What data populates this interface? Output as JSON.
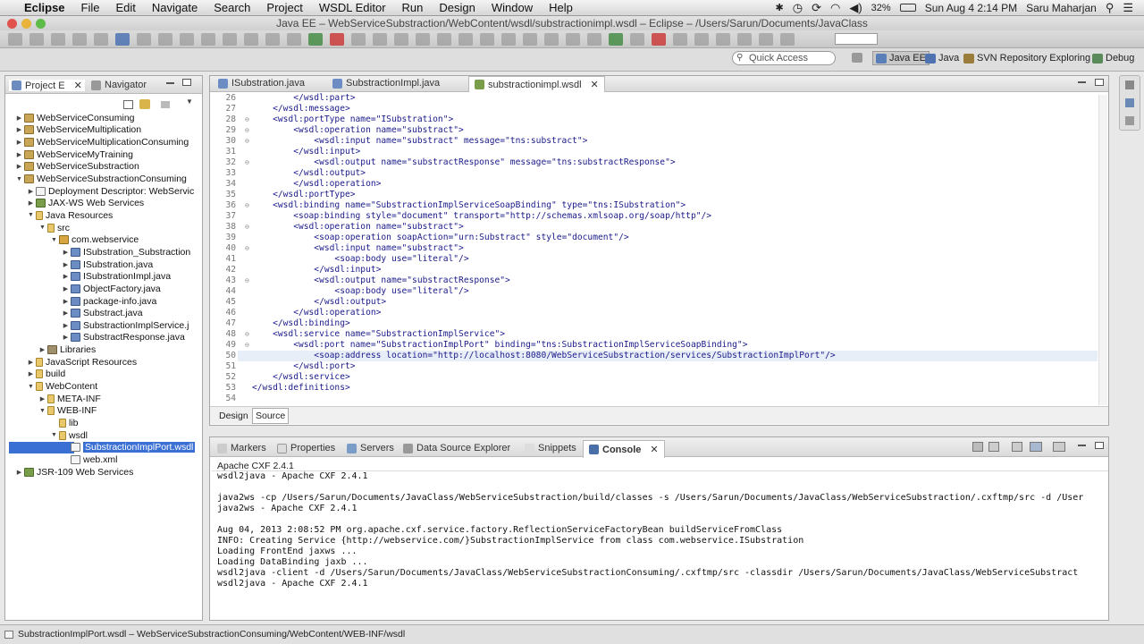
{
  "menubar": {
    "app": "Eclipse",
    "items": [
      "File",
      "Edit",
      "Navigate",
      "Search",
      "Project",
      "WSDL Editor",
      "Run",
      "Design",
      "Window",
      "Help"
    ],
    "battery": "32%",
    "datetime": "Sun Aug 4  2:14 PM",
    "user": "Saru Maharjan"
  },
  "window": {
    "title": "Java EE – WebServiceSubstraction/WebContent/wsdl/substractionimpl.wsdl – Eclipse – /Users/Sarun/Documents/JavaClass"
  },
  "perspectives": {
    "quick_access": "Quick Access",
    "items": [
      "Java EE",
      "Java",
      "SVN Repository Exploring",
      "Debug"
    ]
  },
  "left_panel": {
    "tabs": [
      "Project E",
      "Navigator"
    ],
    "tree": [
      {
        "label": "WebServiceConsuming",
        "indent": 0,
        "tw": "▶",
        "icon": "proj"
      },
      {
        "label": "WebServiceMultiplication",
        "indent": 0,
        "tw": "▶",
        "icon": "proj"
      },
      {
        "label": "WebServiceMultiplicationConsuming",
        "indent": 0,
        "tw": "▶",
        "icon": "proj"
      },
      {
        "label": "WebServiceMyTraining",
        "indent": 0,
        "tw": "▶",
        "icon": "proj"
      },
      {
        "label": "WebServiceSubstraction",
        "indent": 0,
        "tw": "▶",
        "icon": "proj"
      },
      {
        "label": "WebServiceSubstractionConsuming",
        "indent": 0,
        "tw": "▼",
        "icon": "proj"
      },
      {
        "label": "Deployment Descriptor: WebServic",
        "indent": 1,
        "tw": "▶",
        "icon": "file"
      },
      {
        "label": "JAX-WS Web Services",
        "indent": 1,
        "tw": "▶",
        "icon": "ws"
      },
      {
        "label": "Java Resources",
        "indent": 1,
        "tw": "▼",
        "icon": "fold"
      },
      {
        "label": "src",
        "indent": 2,
        "tw": "▼",
        "icon": "fold"
      },
      {
        "label": "com.webservice",
        "indent": 3,
        "tw": "▼",
        "icon": "pkg"
      },
      {
        "label": "ISubstration_Substraction",
        "indent": 4,
        "tw": "▶",
        "icon": "java"
      },
      {
        "label": "ISubstration.java",
        "indent": 4,
        "tw": "▶",
        "icon": "java"
      },
      {
        "label": "ISubstrationImpl.java",
        "indent": 4,
        "tw": "▶",
        "icon": "java"
      },
      {
        "label": "ObjectFactory.java",
        "indent": 4,
        "tw": "▶",
        "icon": "java"
      },
      {
        "label": "package-info.java",
        "indent": 4,
        "tw": "▶",
        "icon": "java"
      },
      {
        "label": "Substract.java",
        "indent": 4,
        "tw": "▶",
        "icon": "java"
      },
      {
        "label": "SubstractionImplService.j",
        "indent": 4,
        "tw": "▶",
        "icon": "java"
      },
      {
        "label": "SubstractResponse.java",
        "indent": 4,
        "tw": "▶",
        "icon": "java"
      },
      {
        "label": "Libraries",
        "indent": 2,
        "tw": "▶",
        "icon": "lib"
      },
      {
        "label": "JavaScript Resources",
        "indent": 1,
        "tw": "▶",
        "icon": "fold"
      },
      {
        "label": "build",
        "indent": 1,
        "tw": "▶",
        "icon": "fold"
      },
      {
        "label": "WebContent",
        "indent": 1,
        "tw": "▼",
        "icon": "fold"
      },
      {
        "label": "META-INF",
        "indent": 2,
        "tw": "▶",
        "icon": "fold"
      },
      {
        "label": "WEB-INF",
        "indent": 2,
        "tw": "▼",
        "icon": "fold"
      },
      {
        "label": "lib",
        "indent": 3,
        "tw": "",
        "icon": "fold"
      },
      {
        "label": "wsdl",
        "indent": 3,
        "tw": "▼",
        "icon": "fold"
      },
      {
        "label": "SubstractionImplPort.wsdl",
        "indent": 4,
        "tw": "",
        "icon": "file",
        "selected": true
      },
      {
        "label": "web.xml",
        "indent": 4,
        "tw": "",
        "icon": "file"
      },
      {
        "label": "JSR-109 Web Services",
        "indent": 0,
        "tw": "▶",
        "icon": "ws"
      }
    ]
  },
  "editor": {
    "tabs": [
      "ISubstration.java",
      "SubstractionImpl.java",
      "substractionimpl.wsdl"
    ],
    "active_tab": "substractionimpl.wsdl",
    "bottom_tabs": [
      "Design",
      "Source"
    ],
    "lines": [
      {
        "n": "26",
        "fold": "",
        "text": "        </wsdl:part>"
      },
      {
        "n": "27",
        "fold": "",
        "text": "    </wsdl:message>"
      },
      {
        "n": "28",
        "fold": "⊖",
        "text": "    <wsdl:portType name=\"ISubstration\">"
      },
      {
        "n": "29",
        "fold": "⊖",
        "text": "        <wsdl:operation name=\"substract\">"
      },
      {
        "n": "30",
        "fold": "⊖",
        "text": "            <wsdl:input name=\"substract\" message=\"tns:substract\">"
      },
      {
        "n": "31",
        "fold": "",
        "text": "        </wsdl:input>"
      },
      {
        "n": "32",
        "fold": "⊖",
        "text": "            <wsdl:output name=\"substractResponse\" message=\"tns:substractResponse\">"
      },
      {
        "n": "33",
        "fold": "",
        "text": "        </wsdl:output>"
      },
      {
        "n": "34",
        "fold": "",
        "text": "        </wsdl:operation>"
      },
      {
        "n": "35",
        "fold": "",
        "text": "    </wsdl:portType>"
      },
      {
        "n": "36",
        "fold": "⊖",
        "text": "    <wsdl:binding name=\"SubstractionImplServiceSoapBinding\" type=\"tns:ISubstration\">"
      },
      {
        "n": "37",
        "fold": "",
        "text": "        <soap:binding style=\"document\" transport=\"http://schemas.xmlsoap.org/soap/http\"/>"
      },
      {
        "n": "38",
        "fold": "⊖",
        "text": "        <wsdl:operation name=\"substract\">"
      },
      {
        "n": "39",
        "fold": "",
        "text": "            <soap:operation soapAction=\"urn:Substract\" style=\"document\"/>"
      },
      {
        "n": "40",
        "fold": "⊖",
        "text": "            <wsdl:input name=\"substract\">"
      },
      {
        "n": "41",
        "fold": "",
        "text": "                <soap:body use=\"literal\"/>"
      },
      {
        "n": "42",
        "fold": "",
        "text": "            </wsdl:input>"
      },
      {
        "n": "43",
        "fold": "⊖",
        "text": "            <wsdl:output name=\"substractResponse\">"
      },
      {
        "n": "44",
        "fold": "",
        "text": "                <soap:body use=\"literal\"/>"
      },
      {
        "n": "45",
        "fold": "",
        "text": "            </wsdl:output>"
      },
      {
        "n": "46",
        "fold": "",
        "text": "        </wsdl:operation>"
      },
      {
        "n": "47",
        "fold": "",
        "text": "    </wsdl:binding>"
      },
      {
        "n": "48",
        "fold": "⊖",
        "text": "    <wsdl:service name=\"SubstractionImplService\">"
      },
      {
        "n": "49",
        "fold": "⊖",
        "text": "        <wsdl:port name=\"SubstractionImplPort\" binding=\"tns:SubstractionImplServiceSoapBinding\">"
      },
      {
        "n": "50",
        "fold": "",
        "text": "            <soap:address location=\"http://localhost:8080/WebServiceSubstraction/services/SubstractionImplPort\"/>",
        "highlight": true
      },
      {
        "n": "51",
        "fold": "",
        "text": "        </wsdl:port>"
      },
      {
        "n": "52",
        "fold": "",
        "text": "    </wsdl:service>"
      },
      {
        "n": "53",
        "fold": "",
        "text": "</wsdl:definitions>"
      },
      {
        "n": "54",
        "fold": "",
        "text": ""
      }
    ]
  },
  "console": {
    "tabs": [
      "Markers",
      "Properties",
      "Servers",
      "Data Source Explorer",
      "Snippets",
      "Console"
    ],
    "active_tab": "Console",
    "header": "Apache CXF 2.4.1",
    "lines": [
      "wsdl2java - Apache CXF 2.4.1",
      "",
      "java2ws -cp /Users/Sarun/Documents/JavaClass/WebServiceSubstraction/build/classes -s /Users/Sarun/Documents/JavaClass/WebServiceSubstraction/.cxftmp/src -d /User",
      "java2ws - Apache CXF 2.4.1",
      "",
      "Aug 04, 2013 2:08:52 PM org.apache.cxf.service.factory.ReflectionServiceFactoryBean buildServiceFromClass",
      "INFO: Creating Service {http://webservice.com/}SubstractionImplService from class com.webservice.ISubstration",
      "Loading FrontEnd jaxws ...",
      "Loading DataBinding jaxb ...",
      "wsdl2java -client -d /Users/Sarun/Documents/JavaClass/WebServiceSubstractionConsuming/.cxftmp/src -classdir /Users/Sarun/Documents/JavaClass/WebServiceSubstract",
      "wsdl2java - Apache CXF 2.4.1"
    ]
  },
  "status": {
    "text": "SubstractionImplPort.wsdl – WebServiceSubstractionConsuming/WebContent/WEB-INF/wsdl"
  }
}
